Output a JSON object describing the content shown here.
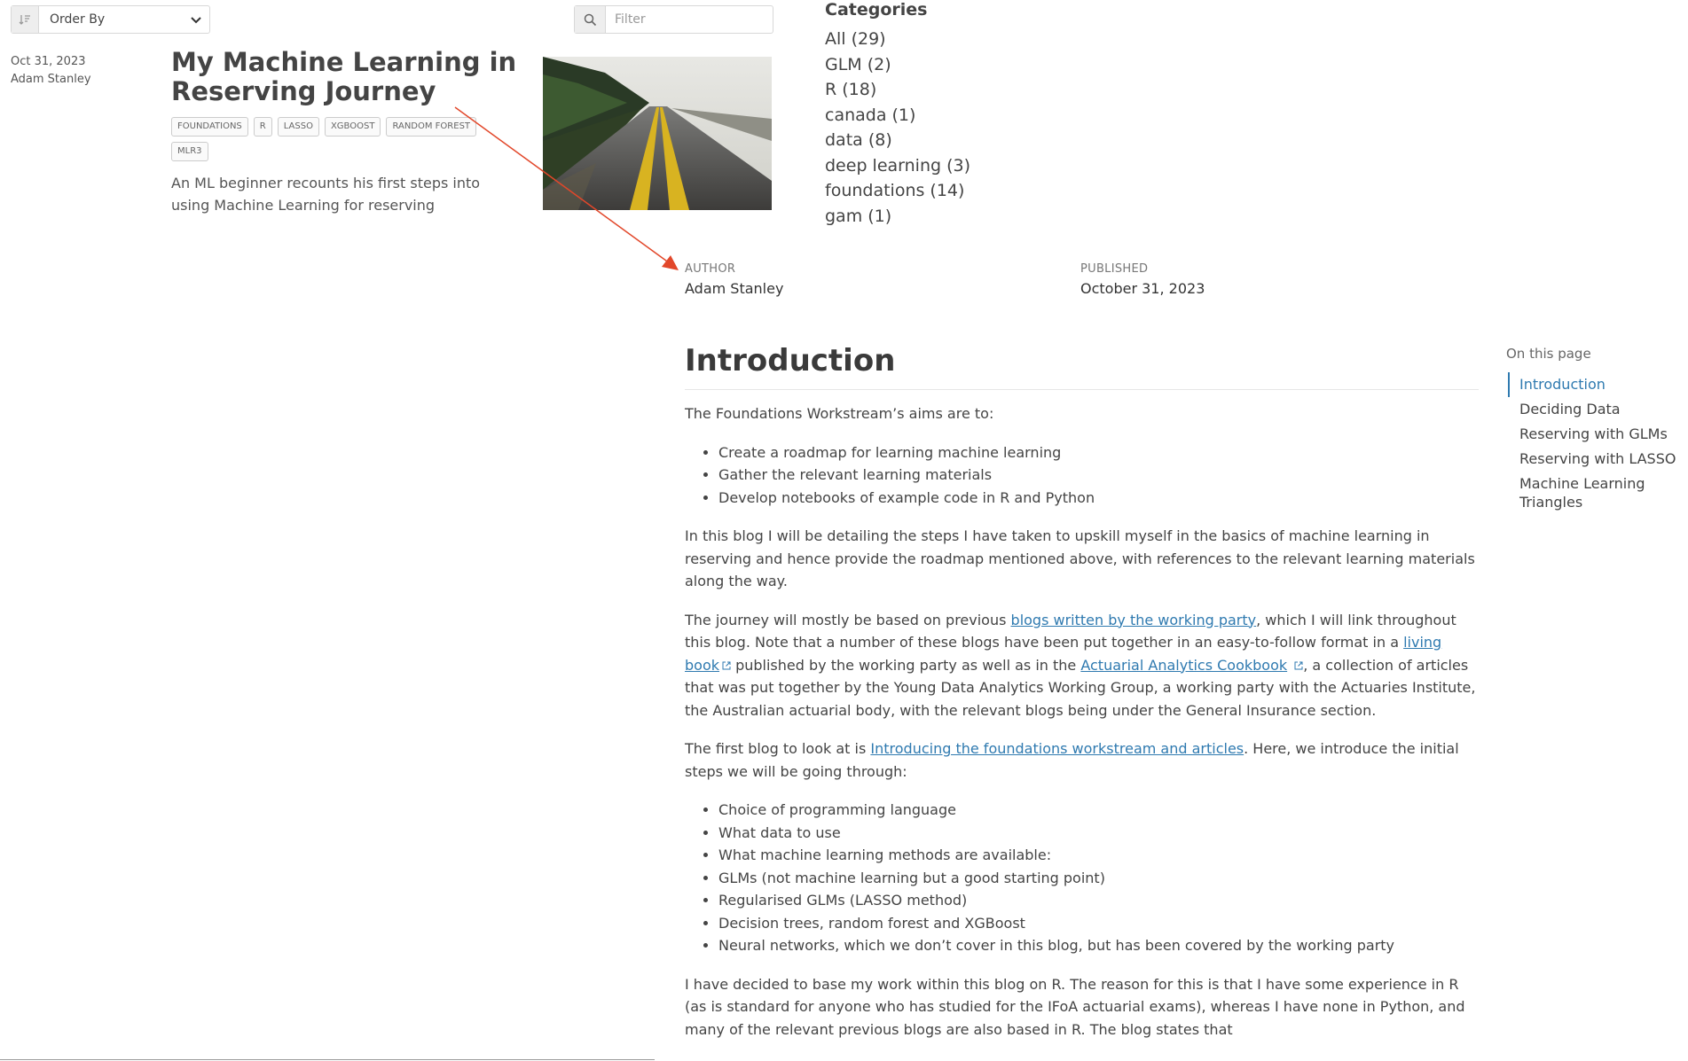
{
  "controls": {
    "order_by_label": "Order By",
    "filter_placeholder": "Filter"
  },
  "post": {
    "date": "Oct 31, 2023",
    "author": "Adam Stanley",
    "title": "My Machine Learning in Reserving Journey",
    "tags": [
      "FOUNDATIONS",
      "R",
      "LASSO",
      "XGBOOST",
      "RANDOM FOREST",
      "MLR3"
    ],
    "description": "An ML beginner recounts his first steps into using Machine Learning for reserving"
  },
  "categories": {
    "heading": "Categories",
    "items": [
      "All (29)",
      "GLM (2)",
      "R (18)",
      "canada (1)",
      "data (8)",
      "deep learning (3)",
      "foundations (14)",
      "gam (1)"
    ]
  },
  "meta": {
    "author_label": "AUTHOR",
    "author": "Adam Stanley",
    "published_label": "PUBLISHED",
    "published": "October 31, 2023"
  },
  "article": {
    "heading": "Introduction",
    "p1": "The Foundations Workstream’s aims are to:",
    "aims": [
      "Create a roadmap for learning machine learning",
      "Gather the relevant learning materials",
      "Develop notebooks of example code in R and Python"
    ],
    "p2": "In this blog I will be detailing the steps I have taken to upskill myself in the basics of machine learning in reserving and hence provide the roadmap mentioned above, with references to the relevant learning materials along the way.",
    "p3_a": "The journey will mostly be based on previous ",
    "p3_link1": "blogs written by the working party",
    "p3_b": ", which I will link throughout this blog. Note that a number of these blogs have been put together in an easy-to-follow format in a ",
    "p3_link2": "living book",
    "p3_c": " published by the working party as well as in the ",
    "p3_link3": "Actuarial Analytics Cookbook",
    "p3_d": ", a collection of articles that was put together by the Young Data Analytics Working Group, a working party with the Actuaries Institute, the Australian actuarial body, with the relevant blogs being under the General Insurance section.",
    "p4_a": "The first blog to look at is ",
    "p4_link": "Introducing the foundations workstream and articles",
    "p4_b": ". Here, we introduce the initial steps we will be going through:",
    "steps": [
      "Choice of programming language",
      "What data to use",
      "What machine learning methods are available:",
      "GLMs (not machine learning but a good starting point)",
      "Regularised GLMs (LASSO method)",
      "Decision trees, random forest and XGBoost",
      "Neural networks, which we don’t cover in this blog, but has been covered by the working party"
    ],
    "p5": "I have decided to base my work within this blog on R. The reason for this is that I have some experience in R (as is standard for anyone who has studied for the IFoA actuarial exams), whereas I have none in Python, and many of the relevant previous blogs are also based in R. The blog states that"
  },
  "toc": {
    "title": "On this page",
    "items": [
      "Introduction",
      "Deciding Data",
      "Reserving with GLMs",
      "Reserving with LASSO",
      "Machine Learning Triangles"
    ]
  }
}
